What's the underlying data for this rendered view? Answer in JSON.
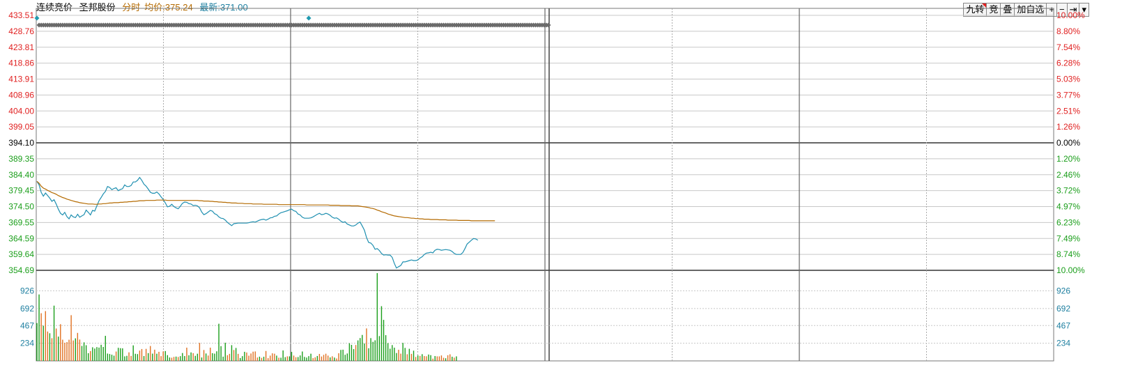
{
  "header": {
    "mode": "连续竞价",
    "stock_name": "圣邦股份",
    "view": "分时",
    "avg_label": "均价:",
    "avg_value": "375.24",
    "latest_label": "最新:",
    "latest_value": "371.00"
  },
  "toolbar": {
    "nine_turn": "九转",
    "auction": "竞",
    "overlay": "叠",
    "add_watch": "加自选",
    "zoom_in": "+",
    "zoom_out": "−",
    "jump_end": "⇥",
    "dropdown": "▾"
  },
  "colors": {
    "up": "#e02020",
    "down": "#1a9e1a",
    "neutral": "#000000",
    "price_line": "#1e8fb0",
    "avg_line": "#b46a00",
    "grid": "#888888",
    "volume_axis": "#1e7fa0"
  },
  "chart_data": {
    "type": "line",
    "title": "",
    "prev_close": 394.1,
    "price_axis": {
      "left_labels": [
        "433.51",
        "428.76",
        "423.81",
        "418.86",
        "413.91",
        "408.96",
        "404.00",
        "399.05",
        "394.10",
        "389.35",
        "384.40",
        "379.45",
        "374.50",
        "369.55",
        "364.59",
        "359.64",
        "354.69"
      ],
      "right_labels": [
        "10.00%",
        "8.80%",
        "7.54%",
        "6.28%",
        "5.03%",
        "3.77%",
        "2.51%",
        "1.26%",
        "0.00%",
        "1.20%",
        "2.46%",
        "3.72%",
        "4.97%",
        "6.23%",
        "7.49%",
        "8.74%",
        "10.00%"
      ],
      "ylim": [
        354.69,
        433.51
      ]
    },
    "volume_axis": {
      "labels": [
        "926",
        "692",
        "467",
        "234"
      ],
      "values": [
        926,
        692,
        467,
        234
      ],
      "ylim": [
        0,
        1160
      ]
    },
    "minutes_total": 240,
    "series": [
      {
        "name": "最新",
        "values": [
          382.2,
          381.1,
          378.8,
          377.6,
          378.6,
          377.8,
          377.0,
          376.0,
          376.5,
          375.2,
          373.6,
          372.3,
          371.8,
          372.6,
          371.3,
          370.6,
          371.8,
          371.2,
          371.0,
          372.0,
          371.1,
          371.5,
          371.9,
          373.3,
          372.6,
          371.8,
          373.2,
          373.0,
          374.6,
          376.2,
          377.2,
          378.3,
          379.1,
          380.6,
          380.3,
          379.6,
          380.0,
          380.2,
          379.3,
          379.7,
          379.9,
          381.1,
          380.6,
          380.6,
          380.9,
          382.0,
          382.0,
          382.5,
          383.4,
          382.5,
          381.3,
          380.7,
          379.8,
          378.8,
          378.5,
          378.5,
          378.9,
          378.3,
          377.4,
          376.6,
          375.5,
          374.3,
          374.5,
          375.1,
          374.4,
          374.0,
          373.7,
          374.5,
          375.4,
          375.8,
          375.7,
          375.3,
          375.2,
          374.7,
          374.8,
          374.6,
          374.0,
          372.7,
          371.9,
          372.2,
          372.7,
          373.2,
          373.0,
          372.2,
          371.9,
          371.2,
          370.8,
          370.7,
          370.2,
          369.5,
          369.0,
          368.5,
          369.1,
          369.2,
          369.3,
          369.3,
          369.3,
          369.3,
          369.3,
          369.4,
          369.6,
          369.7,
          369.6,
          369.9,
          370.2,
          370.4,
          370.5,
          370.2,
          370.5,
          370.9,
          371.0,
          371.4,
          371.5,
          372.1,
          372.5,
          372.7,
          372.9,
          373.1,
          373.4,
          373.6,
          373.1,
          372.9,
          372.1,
          371.8,
          371.1,
          370.8,
          370.8,
          370.8,
          370.9,
          371.2,
          371.6,
          372.0,
          372.3,
          371.9,
          372.0,
          372.3,
          372.1,
          371.7,
          371.1,
          370.8,
          370.9,
          370.5,
          369.9,
          369.5,
          369.7,
          369.0,
          368.7,
          368.4,
          368.4,
          368.7,
          369.3,
          369.6,
          368.4,
          367.1,
          364.8,
          363.3,
          363.1,
          362.4,
          361.2,
          361.4,
          360.8,
          359.9,
          359.4,
          359.5,
          359.4,
          359.4,
          358.7,
          356.8,
          355.4,
          355.8,
          356.2,
          357.3,
          357.3,
          357.5,
          357.7,
          357.9,
          357.7,
          357.7,
          357.9,
          358.5,
          358.9,
          359.6,
          360.0,
          360.1,
          360.3,
          360.1,
          360.9,
          361.2,
          361.1,
          360.9,
          361.0,
          361.1,
          361.0,
          360.9,
          360.5,
          359.9,
          359.6,
          359.6,
          359.6,
          360.2,
          361.4,
          362.8,
          363.4,
          364.0,
          364.5,
          364.4,
          364.0
        ],
        "line_color": "#1e8fb0"
      },
      {
        "name": "均价",
        "values": [
          382.2,
          381.6,
          380.7,
          380.1,
          379.8,
          379.4,
          379.1,
          378.7,
          378.5,
          378.2,
          377.8,
          377.5,
          377.2,
          377.0,
          376.7,
          376.5,
          376.3,
          376.1,
          375.9,
          375.8,
          375.6,
          375.5,
          375.4,
          375.3,
          375.2,
          375.2,
          375.2,
          375.1,
          375.1,
          375.2,
          375.2,
          375.3,
          375.3,
          375.4,
          375.5,
          375.5,
          375.6,
          375.6,
          375.6,
          375.7,
          375.7,
          375.8,
          375.8,
          375.9,
          375.9,
          376.0,
          376.0,
          376.1,
          376.2,
          376.2,
          376.2,
          376.3,
          376.3,
          376.3,
          376.3,
          376.3,
          376.4,
          376.4,
          376.4,
          376.4,
          376.4,
          376.3,
          376.3,
          376.3,
          376.3,
          376.3,
          376.3,
          376.3,
          376.3,
          376.3,
          376.3,
          376.3,
          376.3,
          376.3,
          376.3,
          376.3,
          376.2,
          376.2,
          376.1,
          376.1,
          376.1,
          376.0,
          376.0,
          375.9,
          375.9,
          375.8,
          375.8,
          375.7,
          375.7,
          375.6,
          375.6,
          375.5,
          375.5,
          375.5,
          375.4,
          375.4,
          375.4,
          375.3,
          375.3,
          375.3,
          375.3,
          375.2,
          375.2,
          375.2,
          375.2,
          375.2,
          375.1,
          375.1,
          375.1,
          375.1,
          375.1,
          375.1,
          375.1,
          375.0,
          375.0,
          375.0,
          375.0,
          375.0,
          375.0,
          375.0,
          375.0,
          375.0,
          375.0,
          375.0,
          375.0,
          375.0,
          374.9,
          374.9,
          374.9,
          374.9,
          374.9,
          374.9,
          374.9,
          374.9,
          374.9,
          374.9,
          374.9,
          374.8,
          374.8,
          374.8,
          374.8,
          374.8,
          374.7,
          374.7,
          374.7,
          374.7,
          374.7,
          374.6,
          374.6,
          374.6,
          374.6,
          374.5,
          374.4,
          374.3,
          374.2,
          374.1,
          373.9,
          373.8,
          373.6,
          373.3,
          373.1,
          372.8,
          372.6,
          372.4,
          372.1,
          371.9,
          371.7,
          371.5,
          371.4,
          371.3,
          371.2,
          371.1,
          371.0,
          371.0,
          370.9,
          370.8,
          370.8,
          370.7,
          370.7,
          370.6,
          370.6,
          370.5,
          370.5,
          370.5,
          370.4,
          370.4,
          370.4,
          370.4,
          370.3,
          370.3,
          370.3,
          370.3,
          370.2,
          370.2,
          370.2,
          370.2,
          370.2,
          370.1,
          370.1,
          370.1,
          370.1,
          370.1,
          370.1,
          370.0,
          370.0,
          370.0,
          370.0,
          370.0,
          370.0,
          370.0,
          370.0,
          370.0,
          370.0,
          370.0,
          370.0
        ],
        "line_color": "#b46a00"
      }
    ],
    "volume": [
      500,
      878,
      630,
      465,
      658,
      388,
      365,
      300,
      730,
      428,
      321,
      485,
      280,
      240,
      248,
      280,
      604,
      270,
      298,
      370,
      282,
      198,
      245,
      207,
      102,
      130,
      180,
      163,
      182,
      176,
      213,
      184,
      331,
      97,
      91,
      82,
      69,
      124,
      173,
      168,
      166,
      60,
      67,
      113,
      66,
      205,
      94,
      90,
      136,
      157,
      64,
      159,
      103,
      197,
      96,
      148,
      95,
      120,
      63,
      125,
      130,
      76,
      45,
      42,
      53,
      57,
      52,
      63,
      104,
      64,
      175,
      74,
      112,
      102,
      67,
      95,
      238,
      45,
      144,
      98,
      71,
      175,
      102,
      96,
      127,
      491,
      195,
      56,
      240,
      75,
      93,
      208,
      144,
      171,
      93,
      38,
      63,
      120,
      111,
      69,
      98,
      122,
      125,
      45,
      56,
      40,
      55,
      131,
      36,
      70,
      100,
      95,
      70,
      42,
      42,
      138,
      50,
      60,
      60,
      119,
      70,
      49,
      51,
      72,
      124,
      53,
      44,
      63,
      95,
      37,
      47,
      65,
      92,
      58,
      80,
      95,
      70,
      46,
      61,
      44,
      32,
      101,
      145,
      148,
      81,
      98,
      233,
      212,
      156,
      210,
      271,
      302,
      343,
      230,
      429,
      167,
      301,
      252,
      272,
      1160,
      328,
      723,
      542,
      340,
      235,
      161,
      209,
      175,
      104,
      147,
      96,
      238,
      172,
      88,
      160,
      93,
      135,
      52,
      72,
      66,
      89,
      64,
      61,
      84,
      76,
      30,
      64,
      60,
      60,
      72,
      41,
      35,
      75,
      87,
      55,
      43,
      60
    ],
    "volume_colors": [
      "g",
      "g",
      "r",
      "g",
      "r",
      "r",
      "g",
      "r",
      "g",
      "r",
      "g",
      "r",
      "r",
      "r",
      "r",
      "r",
      "r",
      "r",
      "g",
      "r",
      "r",
      "g",
      "g",
      "g",
      "g",
      "r",
      "g",
      "g",
      "g",
      "g",
      "g",
      "g",
      "g",
      "g",
      "g",
      "g",
      "g",
      "r",
      "g",
      "g",
      "g",
      "g",
      "g",
      "r",
      "r",
      "g",
      "g",
      "g",
      "r",
      "r",
      "g",
      "r",
      "g",
      "r",
      "g",
      "r",
      "g",
      "r",
      "r",
      "r",
      "g",
      "g",
      "g",
      "r",
      "r",
      "g",
      "r",
      "g",
      "g",
      "g",
      "r",
      "g",
      "g",
      "r",
      "g",
      "g",
      "r",
      "g",
      "r",
      "g",
      "r",
      "r",
      "g",
      "g",
      "g",
      "g",
      "g",
      "g",
      "g",
      "r",
      "r",
      "g",
      "r",
      "g",
      "r",
      "g",
      "g",
      "g",
      "r",
      "r",
      "r",
      "r",
      "r",
      "r",
      "g",
      "r",
      "g",
      "r",
      "r",
      "r",
      "r",
      "r",
      "g",
      "r",
      "g",
      "g",
      "g",
      "r",
      "g",
      "g",
      "r",
      "r",
      "g",
      "g",
      "g",
      "g",
      "g",
      "g",
      "g",
      "r",
      "r",
      "g",
      "r",
      "r",
      "r",
      "r",
      "r",
      "g",
      "r",
      "g",
      "r",
      "r",
      "g",
      "g",
      "g",
      "g",
      "g",
      "g",
      "g",
      "r",
      "g",
      "g",
      "g",
      "g",
      "r",
      "g",
      "g",
      "g",
      "g",
      "g",
      "g",
      "g",
      "g",
      "g",
      "g",
      "g",
      "g",
      "g",
      "g",
      "r",
      "r",
      "g",
      "g",
      "r",
      "g",
      "r",
      "g",
      "r",
      "g",
      "r",
      "g",
      "r",
      "r",
      "g",
      "g",
      "r",
      "g",
      "r",
      "r",
      "r",
      "r",
      "g",
      "r",
      "r",
      "g",
      "r",
      "g",
      "g",
      "r",
      "g",
      "g",
      "g",
      "g",
      "g",
      "g"
    ],
    "signal_markers": {
      "top_row_minutes": [
        0,
        127
      ],
      "gap_minutes": [
        8,
        9,
        10,
        11,
        20,
        21,
        22,
        23,
        24,
        25,
        35,
        36,
        37,
        40,
        41,
        42,
        43,
        44,
        45,
        46,
        47,
        48,
        49,
        50,
        51,
        52,
        53,
        54,
        55,
        56,
        58,
        59,
        60,
        61,
        62,
        63,
        64,
        70,
        71,
        72,
        73,
        74,
        75,
        76,
        77,
        78,
        79,
        80,
        81,
        82,
        83,
        84,
        85,
        86,
        87,
        88,
        89,
        90,
        91,
        94,
        95,
        96,
        97,
        98,
        99,
        100,
        101,
        102,
        103,
        104,
        105,
        106,
        107,
        108,
        109,
        110,
        111,
        112,
        113,
        114,
        115,
        116,
        117,
        118,
        119,
        120,
        121,
        122,
        123,
        124,
        125,
        126,
        127,
        128,
        129,
        130,
        131,
        132,
        133,
        134,
        135,
        136,
        137,
        138,
        139,
        140,
        141,
        142,
        143,
        144,
        145,
        146,
        147,
        148,
        149,
        150,
        151,
        152,
        153,
        154,
        155,
        156,
        157,
        158,
        159,
        160,
        161,
        162,
        163,
        164,
        165,
        166,
        167,
        168,
        169,
        170,
        171,
        172,
        173,
        174,
        175,
        176,
        177,
        178,
        179,
        180,
        181,
        182,
        183,
        184,
        185,
        186,
        187,
        188,
        189,
        190,
        191,
        192,
        193,
        194,
        195,
        196,
        197,
        198,
        199,
        200,
        201,
        202,
        203,
        204,
        205,
        206,
        207,
        208,
        209,
        210,
        211,
        212,
        213,
        214,
        215,
        216,
        217,
        218,
        219,
        220,
        221,
        222,
        223,
        224,
        225,
        226,
        227,
        228,
        229,
        230,
        231,
        232,
        233,
        234,
        235,
        236,
        237,
        238,
        239
      ],
      "marker_minutes": [
        1,
        2,
        3,
        4,
        5,
        6,
        7,
        12,
        13,
        14,
        15,
        16,
        17,
        18,
        19,
        26,
        27,
        28,
        29,
        30,
        31,
        32,
        33,
        34,
        38,
        39,
        57,
        65,
        66,
        67,
        68,
        69,
        92,
        93
      ]
    }
  }
}
